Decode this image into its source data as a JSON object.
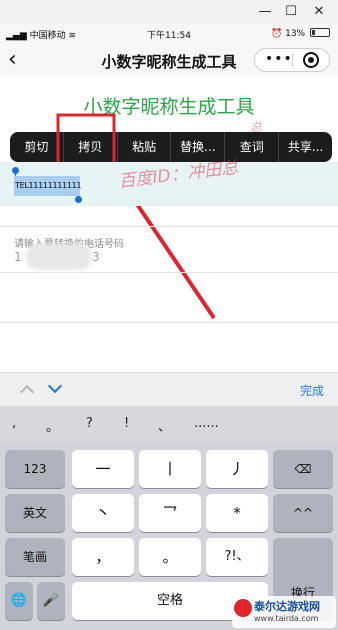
{
  "window": {
    "minimize": "—",
    "maximize": "☐",
    "close": "✕"
  },
  "status_bar": {
    "carrier": "中国移动",
    "time": "下午11:54",
    "battery": "13%"
  },
  "nav": {
    "back": "‹",
    "title": "小数字昵称生成工具",
    "menu": "•••"
  },
  "page": {
    "heading": "小数字昵称生成工具",
    "selected_text": "TEL11111111111",
    "watermark": "百度ID：冲田总",
    "watermark_top": "总",
    "phone_label": "请输入要转换的电话号码",
    "phone_prefix": "1",
    "phone_suffix": "3"
  },
  "context_menu": [
    "剪切",
    "拷贝",
    "粘贴",
    "替换...",
    "查词",
    "共享..."
  ],
  "keyboard_toolbar": {
    "done": "完成"
  },
  "candidates": [
    ",",
    "。",
    "?",
    "!",
    "、",
    "......"
  ],
  "keys": {
    "row1": [
      "123",
      "一",
      "丨",
      "丿",
      "⌫"
    ],
    "row2": [
      "英文",
      "丶",
      "乛",
      "*",
      "^^"
    ],
    "row3": [
      "笔画",
      "，",
      "。",
      "?!、",
      "换行"
    ],
    "row4": [
      "🌐",
      "🎤",
      "空格"
    ]
  },
  "logo": {
    "name": "泰尔达游戏网",
    "url": "www.tairda.com"
  },
  "colors": {
    "heading": "#2aa845",
    "accent": "#1a7de0",
    "highlight": "#e0242c"
  }
}
